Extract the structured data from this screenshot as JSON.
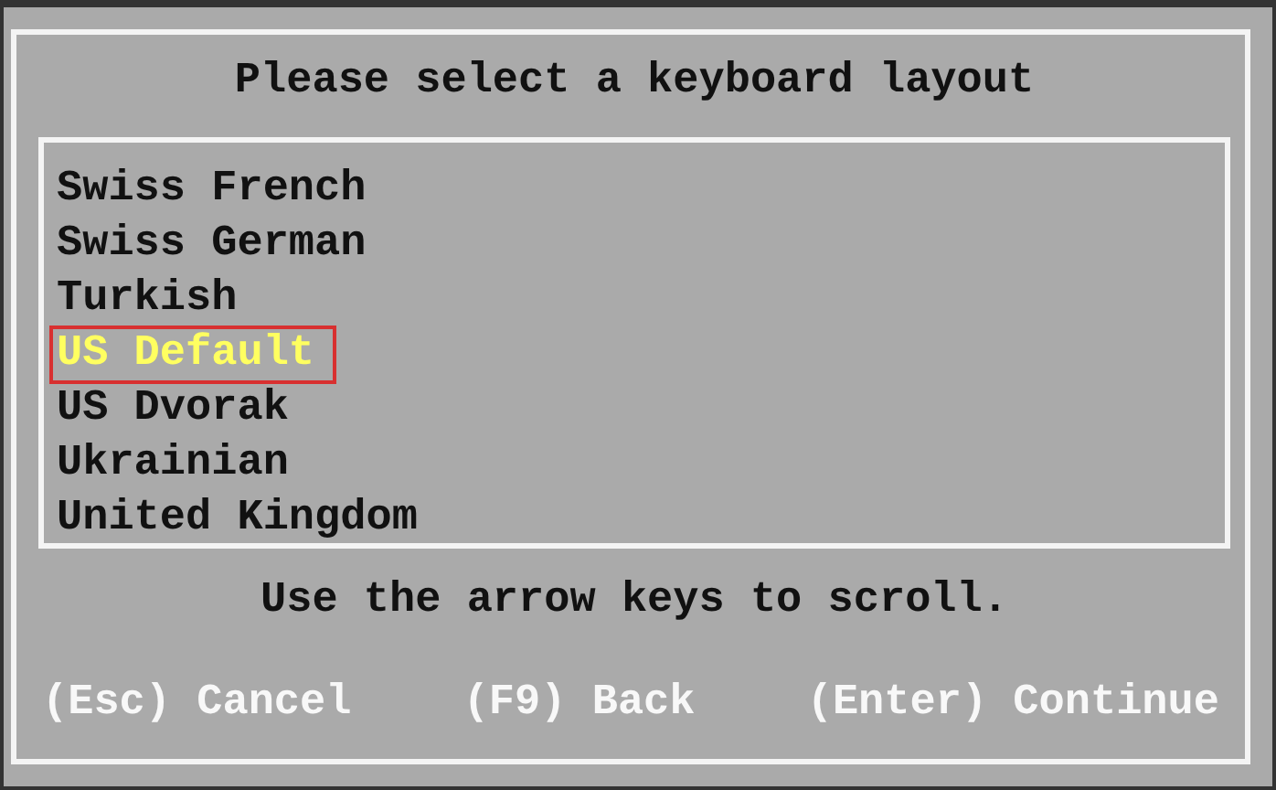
{
  "dialog": {
    "title": "Please select a keyboard layout"
  },
  "layouts": [
    {
      "label": "Swiss French",
      "selected": false
    },
    {
      "label": "Swiss German",
      "selected": false
    },
    {
      "label": "Turkish",
      "selected": false
    },
    {
      "label": "US Default",
      "selected": true
    },
    {
      "label": "US Dvorak",
      "selected": false
    },
    {
      "label": "Ukrainian",
      "selected": false
    },
    {
      "label": "United Kingdom",
      "selected": false
    }
  ],
  "hint": "Use the arrow keys to scroll.",
  "actions": [
    {
      "key": "(Esc)",
      "label": "Cancel"
    },
    {
      "key": "(F9)",
      "label": "Back"
    },
    {
      "key": "(Enter)",
      "label": "Continue"
    }
  ]
}
